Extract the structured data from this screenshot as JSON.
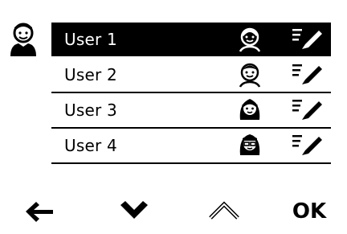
{
  "header": {
    "icon": "user-profile-icon"
  },
  "users": [
    {
      "label": "User 1",
      "avatar": "child-avatar-icon",
      "selected": true
    },
    {
      "label": "User 2",
      "avatar": "boy-avatar-icon",
      "selected": false
    },
    {
      "label": "User 3",
      "avatar": "girl-avatar-icon",
      "selected": false
    },
    {
      "label": "User 4",
      "avatar": "glasses-girl-avatar-icon",
      "selected": false
    }
  ],
  "controls": {
    "back_icon": "arrow-left-icon",
    "down_icon": "chevron-down-icon",
    "up_icon": "chevron-up-icon",
    "ok_label": "OK"
  },
  "colors": {
    "selected_bg": "#000000",
    "selected_fg": "#ffffff",
    "text": "#000000",
    "background": "#ffffff"
  }
}
